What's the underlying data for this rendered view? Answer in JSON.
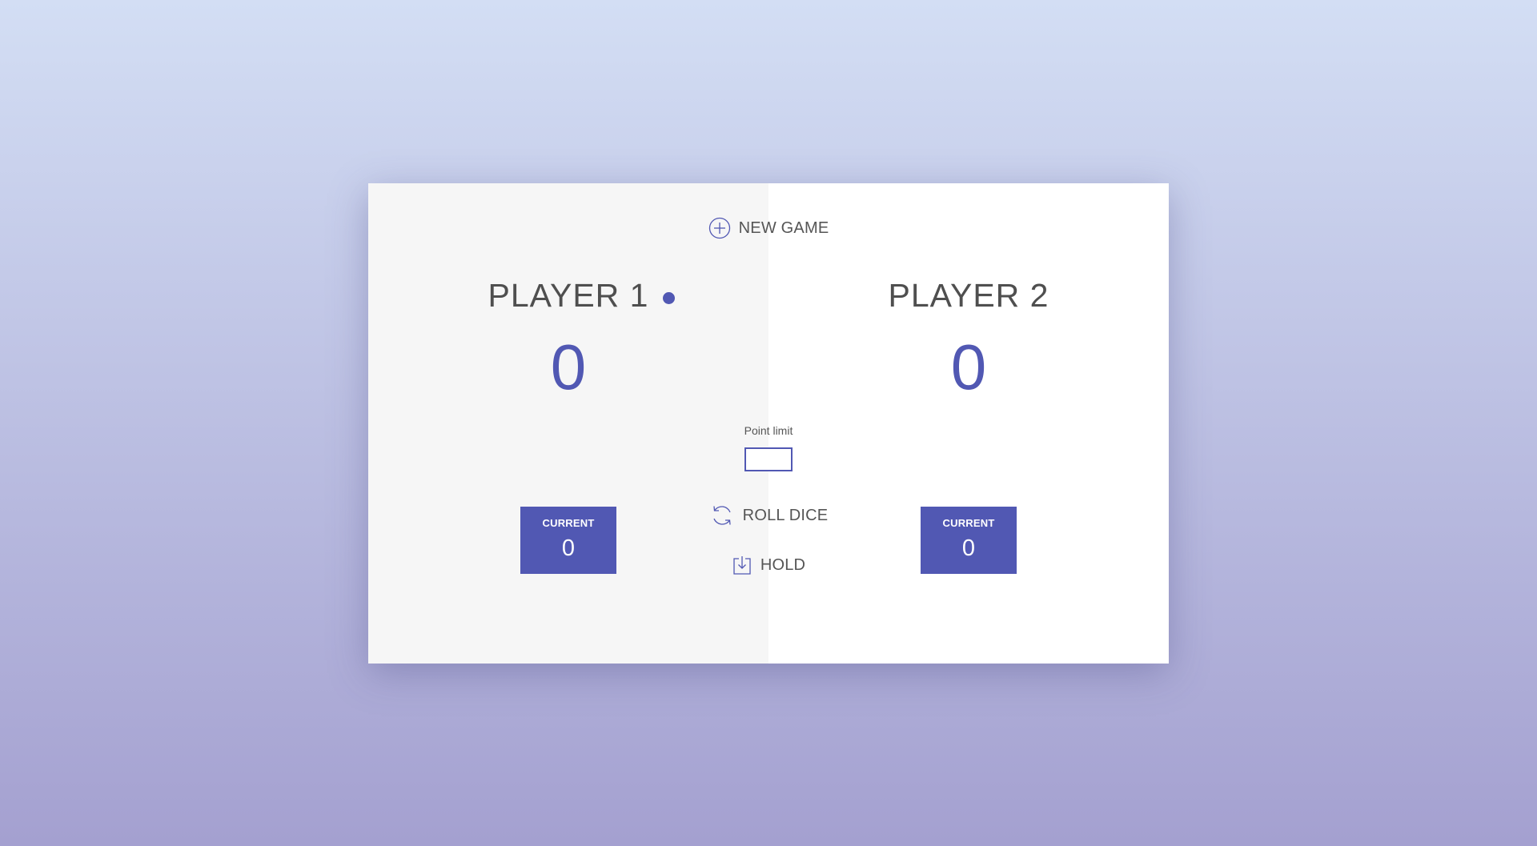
{
  "controls": {
    "new_game_label": "NEW GAME",
    "roll_dice_label": "ROLL DICE",
    "hold_label": "HOLD",
    "point_limit_label": "Point limit",
    "point_limit_value": ""
  },
  "players": [
    {
      "name": "PLAYER 1",
      "score": "0",
      "current_label": "CURRENT",
      "current_score": "0",
      "active": true
    },
    {
      "name": "PLAYER 2",
      "score": "0",
      "current_label": "CURRENT",
      "current_score": "0",
      "active": false
    }
  ],
  "colors": {
    "accent": "#5158b3",
    "panel_active_bg": "#f6f6f6",
    "panel_inactive_bg": "#ffffff",
    "text": "#555555"
  },
  "icons": {
    "new_game": "plus-circle-icon",
    "roll_dice": "refresh-icon",
    "hold": "download-icon",
    "active_player": "active-dot-icon"
  }
}
